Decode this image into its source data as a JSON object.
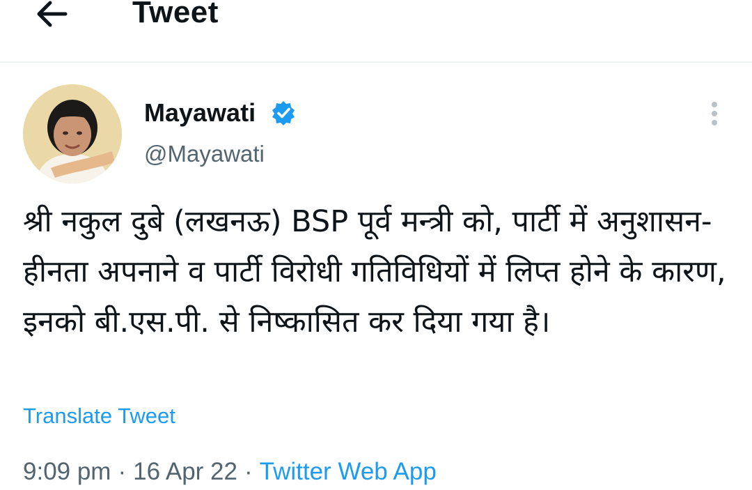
{
  "header": {
    "title": "Tweet",
    "back_icon": "arrow-left-icon"
  },
  "tweet": {
    "author": {
      "display_name": "Mayawati",
      "handle": "@Mayawati",
      "verified": true,
      "verified_icon": "verified-badge-icon"
    },
    "more_icon": "more-vertical-icon",
    "text": "श्री नकुल दुबे (लखनऊ) BSP पूर्व मन्त्री को, पार्टी में अनुशासन-हीनता अपनाने व पार्टी विरोधी गतिविधियों में लिप्त होने के कारण, इनको बी.एस.पी. से निष्कासित कर दिया गया है।",
    "translate_label": "Translate Tweet",
    "time": "9:09 pm",
    "date": "16 Apr 22",
    "source": "Twitter Web App",
    "separator": "·"
  },
  "colors": {
    "accent": "#1d9bf0",
    "text_primary": "#0f1419",
    "text_secondary": "#536471",
    "divider": "#eff3f4"
  }
}
